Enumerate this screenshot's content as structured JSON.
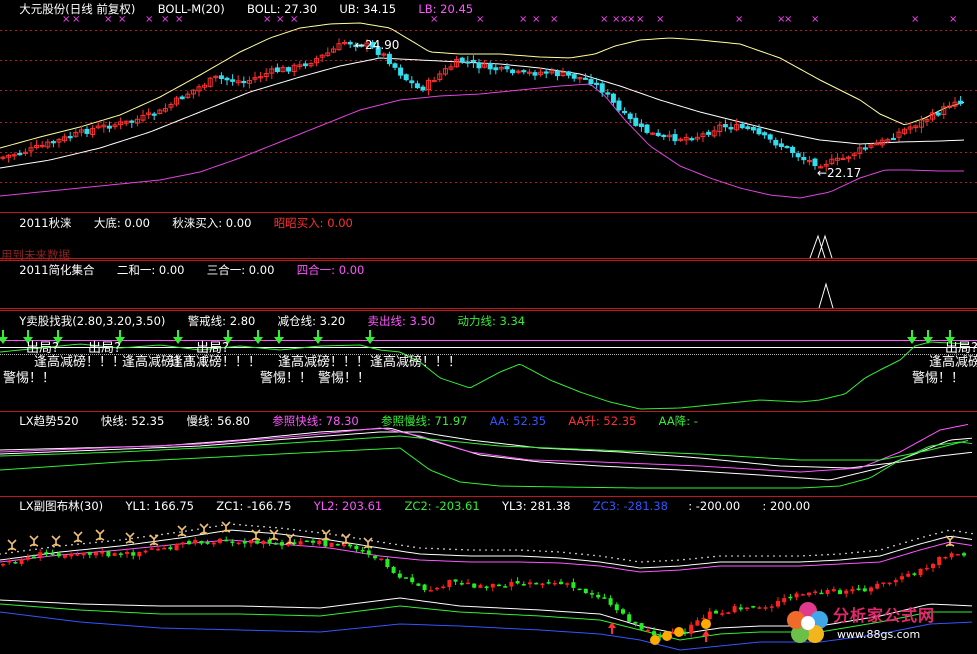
{
  "chart_data": {
    "type": "line",
    "instrument": "大元股份",
    "panels": [
      {
        "id": "boll",
        "header": [
          {
            "text": "大元股份(日线 前复权)",
            "color": "#ffffff"
          },
          {
            "text": "BOLL-M(20)",
            "color": "#ffffff"
          },
          {
            "text": "BOLL: 27.30",
            "color": "#ffffff"
          },
          {
            "text": "UB: 34.15",
            "color": "#ffffff"
          },
          {
            "text": "LB: 20.45",
            "color": "#ff55ff"
          }
        ],
        "price_labels": [
          {
            "text": "←24.90"
          },
          {
            "text": "←22.17"
          }
        ],
        "ylim": [
          19,
          37
        ],
        "extra_text": "用到未来数据"
      },
      {
        "id": "qiulai",
        "header": [
          {
            "text": "2011秋涞",
            "color": "#ffffff"
          },
          {
            "text": "大底: 0.00",
            "color": "#ffffff"
          },
          {
            "text": "秋涞买入: 0.00",
            "color": "#ffffff"
          },
          {
            "text": "昭昭买入: 0.00",
            "color": "#ff3030"
          }
        ],
        "extra_text": "用到未来数据"
      },
      {
        "id": "jianhua",
        "header": [
          {
            "text": "2011简化集合",
            "color": "#ffffff"
          },
          {
            "text": "二和一: 0.00",
            "color": "#ffffff"
          },
          {
            "text": "三合一: 0.00",
            "color": "#ffffff"
          },
          {
            "text": "四合一: 0.00",
            "color": "#ff55ff"
          }
        ]
      },
      {
        "id": "maigu",
        "header": [
          {
            "text": "Y卖股找我(2.80,3.20,3.50)",
            "color": "#ffffff"
          },
          {
            "text": "警戒线: 2.80",
            "color": "#ffffff"
          },
          {
            "text": "减仓线: 3.20",
            "color": "#ffffff"
          },
          {
            "text": "卖出线: 3.50",
            "color": "#ff55ff"
          },
          {
            "text": "动力线: 3.34",
            "color": "#33ee33"
          }
        ],
        "signal_texts": [
          "出局?",
          "逢高减磅！！！",
          "警惕！！"
        ]
      },
      {
        "id": "qushi",
        "header": [
          {
            "text": "LX趋势520",
            "color": "#ffffff"
          },
          {
            "text": "快线: 52.35",
            "color": "#ffffff"
          },
          {
            "text": "慢线: 56.80",
            "color": "#ffffff"
          },
          {
            "text": "参照快线: 78.30",
            "color": "#ff55ff"
          },
          {
            "text": "参照慢线: 71.97",
            "color": "#33ee33"
          },
          {
            "text": "AA: 52.35",
            "color": "#3355ff"
          },
          {
            "text": "AA升: 52.35",
            "color": "#ff3030"
          },
          {
            "text": "AA降: -",
            "color": "#33ee33"
          }
        ]
      },
      {
        "id": "bulin",
        "header": [
          {
            "text": "LX副图布林(30)",
            "color": "#ffffff"
          },
          {
            "text": "YL1: 166.75",
            "color": "#ffffff"
          },
          {
            "text": "ZC1: -166.75",
            "color": "#ffffff"
          },
          {
            "text": "YL2: 203.61",
            "color": "#ff55ff"
          },
          {
            "text": "ZC2: -203.61",
            "color": "#33ee33"
          },
          {
            "text": "YL3: 281.38",
            "color": "#ffffff"
          },
          {
            "text": "ZC3: -281.38",
            "color": "#3355ff"
          },
          {
            "text": ": -200.00",
            "color": "#ffffff"
          },
          {
            "text": ": 200.00",
            "color": "#ffffff"
          }
        ]
      }
    ],
    "colors": {
      "up": "#ff3030",
      "down": "#33ddee",
      "mid": "#ffffff",
      "ub": "#ffff99",
      "lb": "#dd44dd",
      "dline": "#ff2a2a"
    }
  },
  "watermark": {
    "title": "分析家公式网",
    "url": "www.88gs.com"
  }
}
